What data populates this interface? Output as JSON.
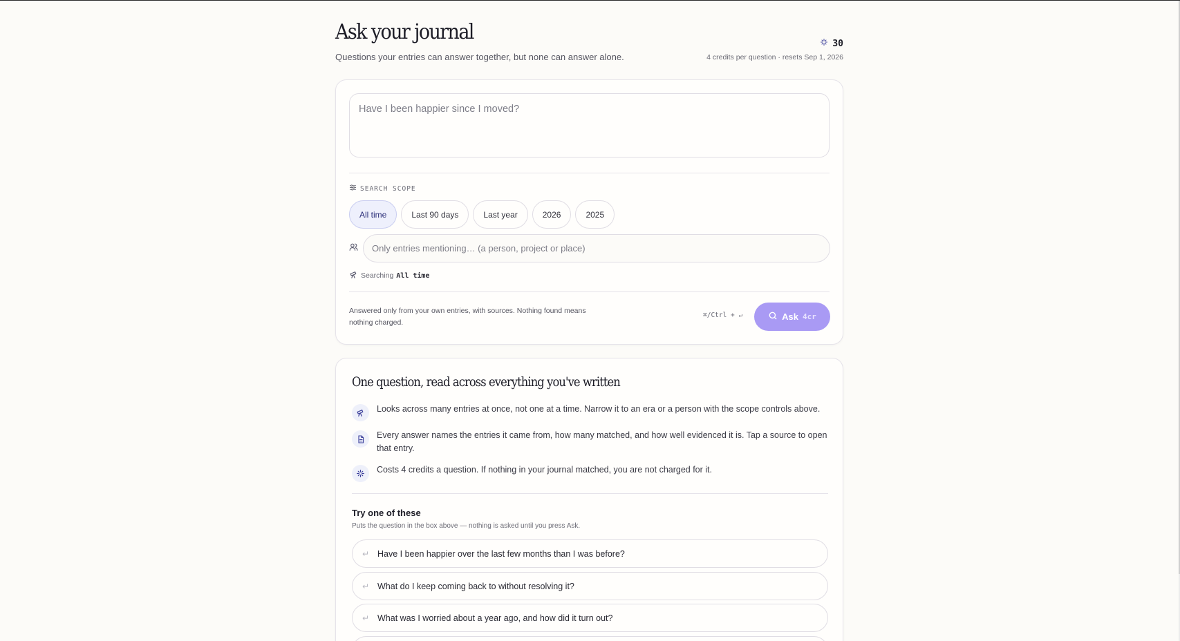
{
  "header": {
    "title": "Ask your journal",
    "subtitle": "Questions your entries can answer together, but none can answer alone.",
    "credits": "30",
    "credits_note": "4 credits per question · resets Sep 1, 2026"
  },
  "ask": {
    "question_placeholder": "Have I been happier since I moved?",
    "question_value": "",
    "scope_label": "SEARCH SCOPE",
    "scopes": [
      {
        "label": "All time",
        "active": true
      },
      {
        "label": "Last 90 days",
        "active": false
      },
      {
        "label": "Last year",
        "active": false
      },
      {
        "label": "2026",
        "active": false
      },
      {
        "label": "2025",
        "active": false
      }
    ],
    "mention_placeholder": "Only entries mentioning… (a person, project or place)",
    "searching_prefix": "Searching",
    "searching_scope": "All time",
    "footer_note": "Answered only from your own entries, with sources. Nothing found means nothing charged.",
    "shortcut": "⌘/Ctrl + ↵",
    "button_label": "Ask",
    "button_cost": "4cr"
  },
  "info": {
    "title": "One question, read across everything you've written",
    "features": [
      {
        "icon": "telescope-icon",
        "text": "Looks across many entries at once, not one at a time. Narrow it to an era or a person with the scope controls above."
      },
      {
        "icon": "document-icon",
        "text": "Every answer names the entries it came from, how many matched, and how well evidenced it is. Tap a source to open that entry."
      },
      {
        "icon": "sparkle-icon",
        "text": "Costs 4 credits a question. If nothing in your journal matched, you are not charged for it."
      }
    ],
    "try_title": "Try one of these",
    "try_subtitle": "Puts the question in the box above — nothing is asked until you press Ask.",
    "suggestions": [
      "Have I been happier over the last few months than I was before?",
      "What do I keep coming back to without resolving it?",
      "What was I worried about a year ago, and how did it turn out?"
    ]
  },
  "colors": {
    "accent": "#a99af4",
    "active_chip_bg": "#eef0fc",
    "icon_color": "#3b3f9a"
  }
}
